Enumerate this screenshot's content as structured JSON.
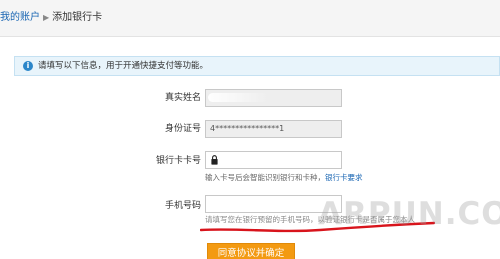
{
  "breadcrumb": {
    "parent": "我的账户",
    "separator": "▶",
    "current": "添加银行卡"
  },
  "info_bar": {
    "icon": "info-icon",
    "icon_glyph": "i",
    "text": "请填写以下信息，用于开通快捷支付等功能。"
  },
  "form": {
    "name": {
      "label": "真实姓名",
      "value": ""
    },
    "id_number": {
      "label": "身份证号",
      "value": "4****************1"
    },
    "card_number": {
      "label": "银行卡卡号",
      "value": "",
      "hint": "输入卡号后会智能识别银行和卡种，",
      "hint_link": "银行卡要求"
    },
    "phone": {
      "label": "手机号码",
      "value": "",
      "hint": "请填写您在银行预留的手机号码，以验证银行卡是否属于您本人"
    }
  },
  "submit": {
    "label": "同意协议并确定"
  },
  "watermark": {
    "text": "ARPUN.COM"
  },
  "colors": {
    "accent_blue": "#1a66b3",
    "button_orange": "#f39a12",
    "annotation_red": "#d8141c",
    "info_bg": "#e8f4fb"
  }
}
